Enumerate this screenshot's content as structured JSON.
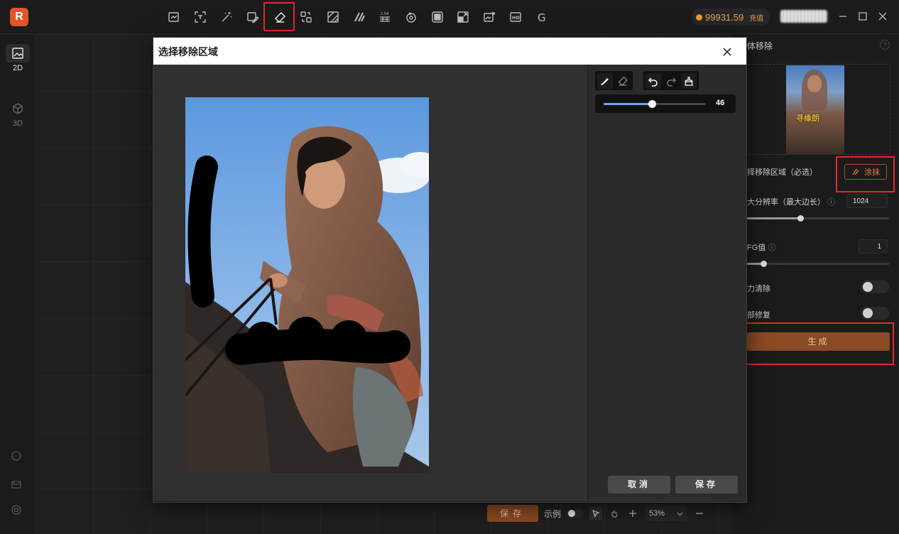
{
  "app": {
    "logo_text": "R"
  },
  "toolbar": {
    "tools": [
      "image-crop-icon",
      "scan-text-icon",
      "magic-wand-icon",
      "image-edit-icon",
      "eraser-icon",
      "swap-icon",
      "hatch-icon",
      "stripe-icon",
      "pixel-scale-icon",
      "rotate-3d-icon",
      "layer-icon",
      "resize-icon",
      "image-upscale-icon",
      "hd-icon",
      "g-icon"
    ],
    "hd_text": "HD",
    "g_text": "G",
    "pixel_text": "2.54"
  },
  "account": {
    "coins": "99931.59",
    "recharge_label": "充值"
  },
  "leftnav": {
    "items": [
      {
        "label": "2D",
        "icon": "image-icon"
      },
      {
        "label": "3D",
        "icon": "cube-icon"
      }
    ]
  },
  "right_panel": {
    "title": "体移除",
    "select_area_label": "择移除区域（必选）",
    "brush_button": "涂抹",
    "resolution_label": "大分辨率（最大边长）",
    "resolution_value": "1024",
    "resolution_slider": 0.38,
    "cfg_label": "FG值",
    "cfg_value": "1",
    "cfg_slider": 0.12,
    "force_clear_label": "力清除",
    "local_repair_label": "部修复",
    "generate_label": "生成",
    "thumbnail_watermark": "寻缘朗"
  },
  "bottombar": {
    "save_label": "保存",
    "example_label": "示例",
    "zoom": "53%"
  },
  "modal": {
    "title": "选择移除区域",
    "brush_size": "46",
    "brush_size_fraction": 0.47,
    "cancel_label": "取消",
    "save_label": "保存"
  },
  "colors": {
    "accent": "#8a4a23",
    "highlight": "#e8262b",
    "coin": "#e5a33b",
    "slider_blue": "#6fa5e8"
  }
}
